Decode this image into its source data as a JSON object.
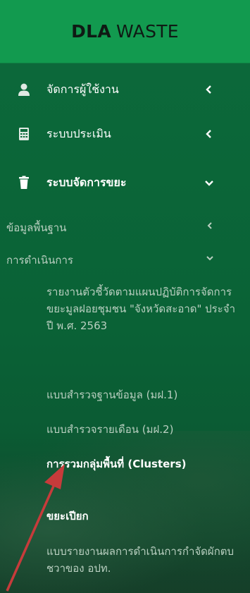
{
  "brand": {
    "strong": "DLA",
    "light": "WASTE"
  },
  "menu": [
    {
      "label": "จัดการผู้ใช้งาน",
      "icon": "user-icon",
      "expanded": false
    },
    {
      "label": "ระบบประเมิน",
      "icon": "calculator-icon",
      "expanded": false
    },
    {
      "label": "ระบบจัดการขยะ",
      "icon": "trash-icon",
      "expanded": true
    }
  ],
  "submenu": [
    {
      "label": "ข้อมูลพื้นฐาน",
      "expanded": false
    },
    {
      "label": "การดำเนินการ",
      "expanded": true
    }
  ],
  "operations": [
    "รายงานตัวชี้วัดตามแผนปฏิบัติการจัดการขยะมูลฝอยชุมชน \"จังหวัดสะอาด\" ประจำปี พ.ศ. 2563",
    "แบบสำรวจฐานข้อมูล (มฝ.1)",
    "แบบสำรวจรายเดือน (มฝ.2)",
    "การรวมกลุ่มพื้นที่ (Clusters)",
    "ขยะเปียก",
    "แบบรายงานผลการดำเนินการกำจัดผักตบชวาของ อปท."
  ],
  "colors": {
    "header": "#129a4f",
    "sidebar": "#0c6a3b",
    "arrow": "#c73b3b"
  }
}
